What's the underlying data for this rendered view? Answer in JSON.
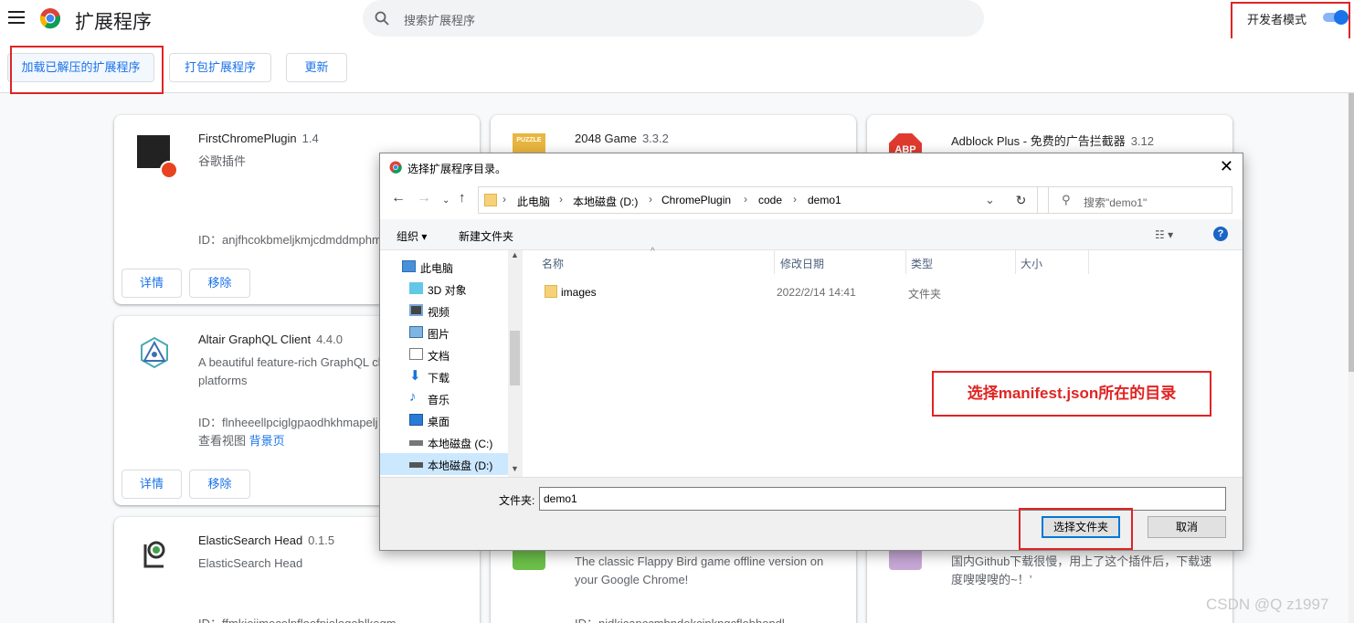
{
  "header": {
    "title": "扩展程序",
    "search_placeholder": "搜索扩展程序",
    "dev_mode_label": "开发者模式",
    "dev_mode_on": true
  },
  "toolbar": {
    "load_unpacked": "加载已解压的扩展程序",
    "pack": "打包扩展程序",
    "update": "更新"
  },
  "cards": [
    {
      "name": "FirstChromePlugin",
      "version": "1.4",
      "description": "谷歌插件",
      "id": "ID：anjfhcokbmeljkmjcdmddmphm",
      "details": "详情",
      "remove": "移除"
    },
    {
      "name": "Altair GraphQL Client",
      "version": "4.4.0",
      "description": "A beautiful feature-rich GraphQL cl platforms",
      "id": "ID：flnheeellpciglgpaodhkhmapelj",
      "views_label": "查看视图",
      "views_link": "背景页",
      "details": "详情",
      "remove": "移除"
    },
    {
      "name": "ElasticSearch Head",
      "version": "0.1.5",
      "description": "ElasticSearch Head",
      "id": "ID：ffmkiejjmecolpfloofpjologoblkegm"
    },
    {
      "name": "2048 Game",
      "version": "3.3.2",
      "icon_text": "PUZZLE"
    },
    {
      "name": "Adblock Plus - 免费的广告拦截器",
      "version": "3.12",
      "icon_text": "ABP"
    },
    {
      "description": "The classic Flappy Bird game offline version on your Google Chrome!",
      "id": "ID：nidkicapccmbndokcinkngcflobhondl"
    },
    {
      "description": "国内Github下载很慢，用上了这个插件后，下载速度嗖嗖嗖的~！’"
    }
  ],
  "dialog": {
    "title": "选择扩展程序目录。",
    "close": "✕",
    "breadcrumbs": [
      "此电脑",
      "本地磁盘 (D:)",
      "ChromePlugin",
      "code",
      "demo1"
    ],
    "search_placeholder": "搜索\"demo1\"",
    "organize": "组织 ▾",
    "new_folder": "新建文件夹",
    "help": "?",
    "tree": [
      {
        "label": "此电脑",
        "icon": "pc-icon"
      },
      {
        "label": "3D 对象",
        "icon": "3d-objects-icon"
      },
      {
        "label": "视频",
        "icon": "video-icon"
      },
      {
        "label": "图片",
        "icon": "pictures-icon"
      },
      {
        "label": "文档",
        "icon": "documents-icon"
      },
      {
        "label": "下载",
        "icon": "downloads-icon"
      },
      {
        "label": "音乐",
        "icon": "music-icon"
      },
      {
        "label": "桌面",
        "icon": "desktop-icon"
      },
      {
        "label": "本地磁盘 (C:)",
        "icon": "drive-icon"
      },
      {
        "label": "本地磁盘 (D:)",
        "icon": "drive-icon",
        "selected": true
      }
    ],
    "columns": [
      "名称",
      "修改日期",
      "类型",
      "大小"
    ],
    "files": [
      {
        "name": "images",
        "date": "2022/2/14 14:41",
        "type": "文件夹",
        "size": ""
      }
    ],
    "annotation": "选择manifest.json所在的目录",
    "folder_label": "文件夹:",
    "folder_value": "demo1",
    "select_button": "选择文件夹",
    "cancel_button": "取消"
  },
  "watermark": "CSDN @Q z1997",
  "colors": {
    "accent": "#1a73e8",
    "annotation_red": "#e02424",
    "dialog_bg": "#f0f0f0"
  }
}
